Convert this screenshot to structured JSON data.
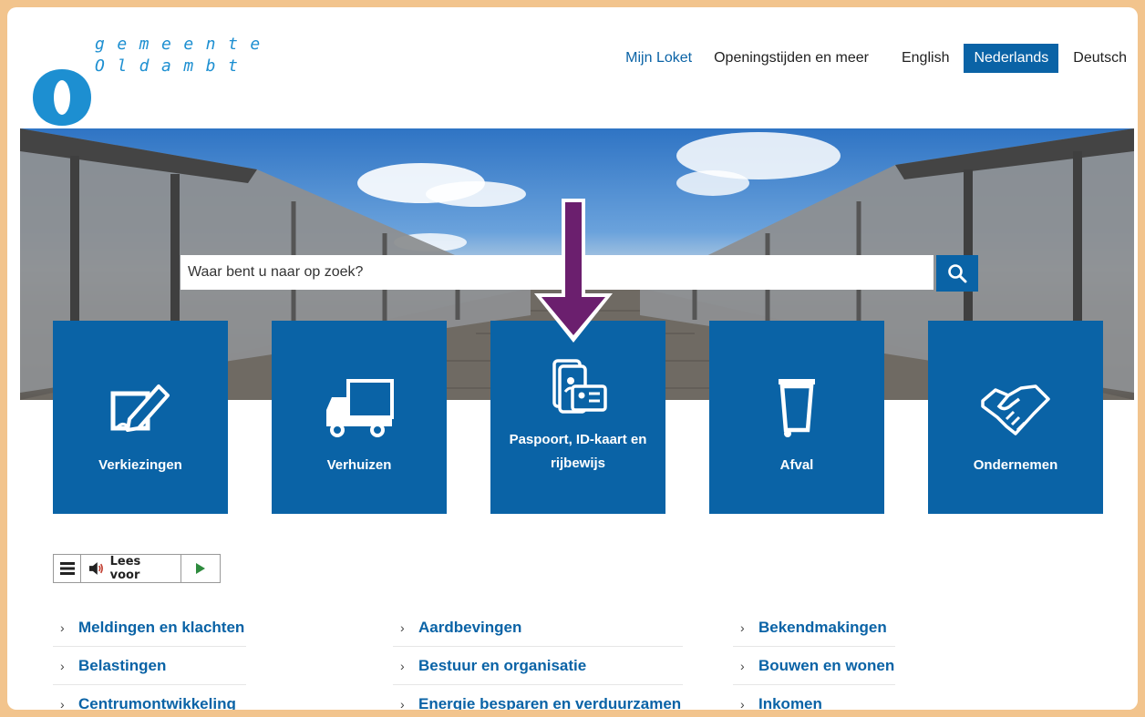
{
  "logo": {
    "line1": "gemeente",
    "line2": "Oldambt"
  },
  "topnav": [
    {
      "label": "Mijn Loket",
      "style": "blue"
    },
    {
      "label": "Openingstijden en meer",
      "style": "plain"
    },
    {
      "label": "English",
      "style": "plain"
    },
    {
      "label": "Nederlands",
      "style": "active"
    },
    {
      "label": "Deutsch",
      "style": "plain"
    }
  ],
  "search": {
    "placeholder": "Waar bent u naar op zoek?",
    "icon": "search-icon"
  },
  "tiles": [
    {
      "label": "Verkiezingen",
      "icon": "ballot-pencil-icon"
    },
    {
      "label": "Verhuizen",
      "icon": "truck-icon"
    },
    {
      "label": "Paspoort, ID-kaart en rijbewijs",
      "icon": "id-card-icon"
    },
    {
      "label": "Afval",
      "icon": "waste-bin-icon"
    },
    {
      "label": "Ondernemen",
      "icon": "handshake-icon"
    }
  ],
  "reader": {
    "label": "Lees voor",
    "menu_icon": "menu-icon",
    "speaker_icon": "speaker-icon",
    "play_icon": "play-icon"
  },
  "links": {
    "col1": [
      "Meldingen en klachten",
      "Belastingen",
      "Centrumontwikkeling"
    ],
    "col2": [
      "Aardbevingen",
      "Bestuur en organisatie",
      "Energie besparen en verduurzamen"
    ],
    "col3": [
      "Bekendmakingen",
      "Bouwen en wonen",
      "Inkomen"
    ]
  },
  "colors": {
    "brand": "#0a63a6",
    "frame": "#f2c48d",
    "annotation_arrow": "#6b1f6e",
    "logo": "#1d8fd1"
  }
}
